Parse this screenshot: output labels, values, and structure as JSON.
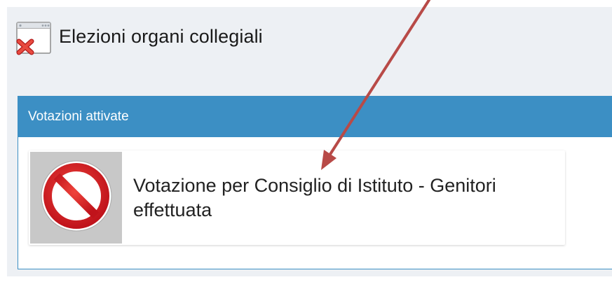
{
  "header": {
    "title": "Elezioni organi collegiali",
    "icon": "window-error-icon"
  },
  "panel": {
    "heading": "Votazioni attivate",
    "card": {
      "text": "Votazione per Consiglio di Istituto - Genitori effettuata",
      "icon": "prohibited-icon"
    }
  },
  "colors": {
    "panel_header": "#3c8fc4",
    "page_bg": "#edf0f4",
    "prohibited_red": "#d5202a",
    "arrow": "#b84a47"
  }
}
